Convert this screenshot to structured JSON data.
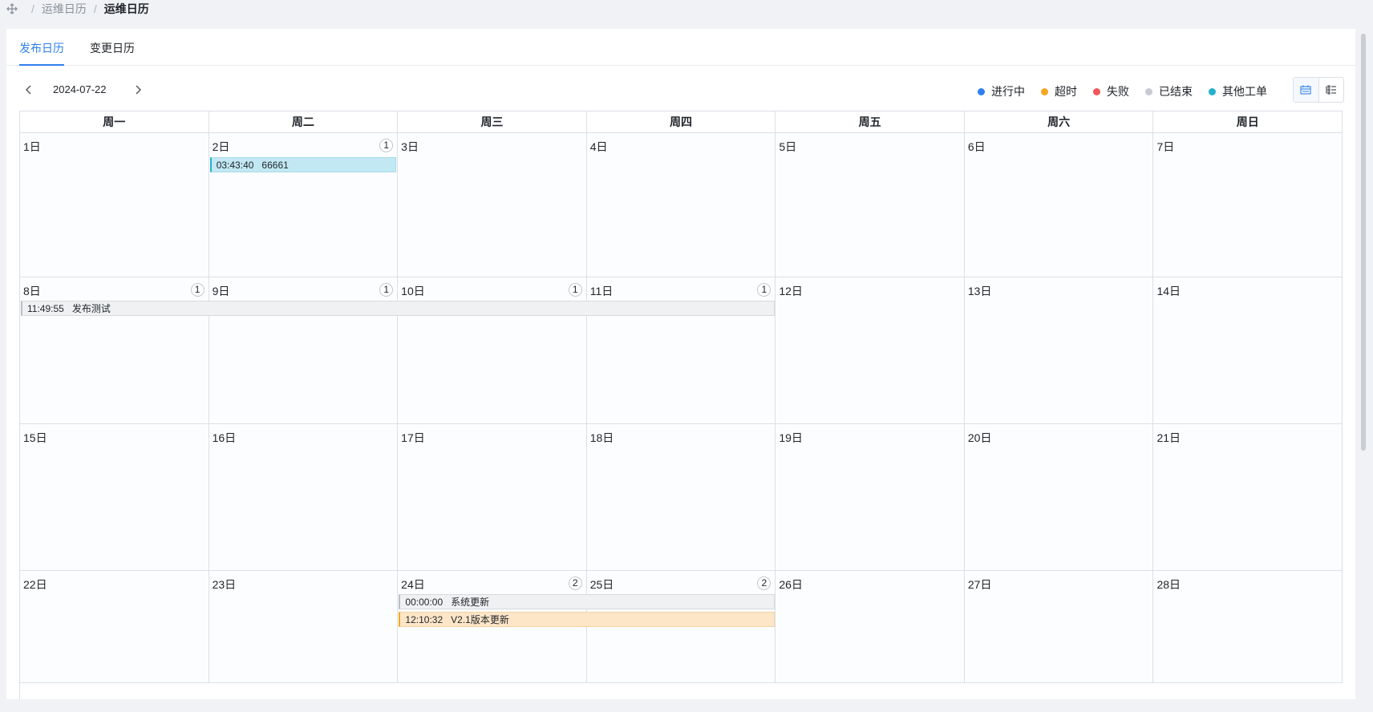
{
  "breadcrumb": {
    "items": [
      "运维日历",
      "运维日历"
    ],
    "separator": "/"
  },
  "tabs": [
    {
      "label": "发布日历",
      "active": true
    },
    {
      "label": "变更日历",
      "active": false
    }
  ],
  "toolbar": {
    "current_date": "2024-07-22"
  },
  "legend": [
    {
      "label": "进行中",
      "color": "#2f80ed"
    },
    {
      "label": "超时",
      "color": "#f5a623"
    },
    {
      "label": "失败",
      "color": "#f0555a"
    },
    {
      "label": "已结束",
      "color": "#c5cad3"
    },
    {
      "label": "其他工单",
      "color": "#27b0cc"
    }
  ],
  "calendar": {
    "weekdays": [
      "周一",
      "周二",
      "周三",
      "周四",
      "周五",
      "周六",
      "周日"
    ],
    "weeks": [
      {
        "days": [
          {
            "label": "1日",
            "count": null
          },
          {
            "label": "2日",
            "count": "1"
          },
          {
            "label": "3日",
            "count": null
          },
          {
            "label": "4日",
            "count": null
          },
          {
            "label": "5日",
            "count": null
          },
          {
            "label": "6日",
            "count": null
          },
          {
            "label": "7日",
            "count": null
          }
        ]
      },
      {
        "days": [
          {
            "label": "8日",
            "count": "1"
          },
          {
            "label": "9日",
            "count": "1"
          },
          {
            "label": "10日",
            "count": "1"
          },
          {
            "label": "11日",
            "count": "1"
          },
          {
            "label": "12日",
            "count": null
          },
          {
            "label": "13日",
            "count": null
          },
          {
            "label": "14日",
            "count": null
          }
        ]
      },
      {
        "days": [
          {
            "label": "15日",
            "count": null
          },
          {
            "label": "16日",
            "count": null
          },
          {
            "label": "17日",
            "count": null
          },
          {
            "label": "18日",
            "count": null
          },
          {
            "label": "19日",
            "count": null
          },
          {
            "label": "20日",
            "count": null
          },
          {
            "label": "21日",
            "count": null
          }
        ]
      },
      {
        "days": [
          {
            "label": "22日",
            "count": null
          },
          {
            "label": "23日",
            "count": null
          },
          {
            "label": "24日",
            "count": "2"
          },
          {
            "label": "25日",
            "count": "2"
          },
          {
            "label": "26日",
            "count": null
          },
          {
            "label": "27日",
            "count": null
          },
          {
            "label": "28日",
            "count": null
          }
        ]
      }
    ],
    "events": [
      {
        "time": "03:43:40",
        "title": "66661",
        "status": "其他工单"
      },
      {
        "time": "11:49:55",
        "title": "发布测试",
        "status": "已结束"
      },
      {
        "time": "00:00:00",
        "title": "系统更新",
        "status": "已结束"
      },
      {
        "time": "12:10:32",
        "title": "V2.1版本更新",
        "status": "超时"
      }
    ]
  }
}
